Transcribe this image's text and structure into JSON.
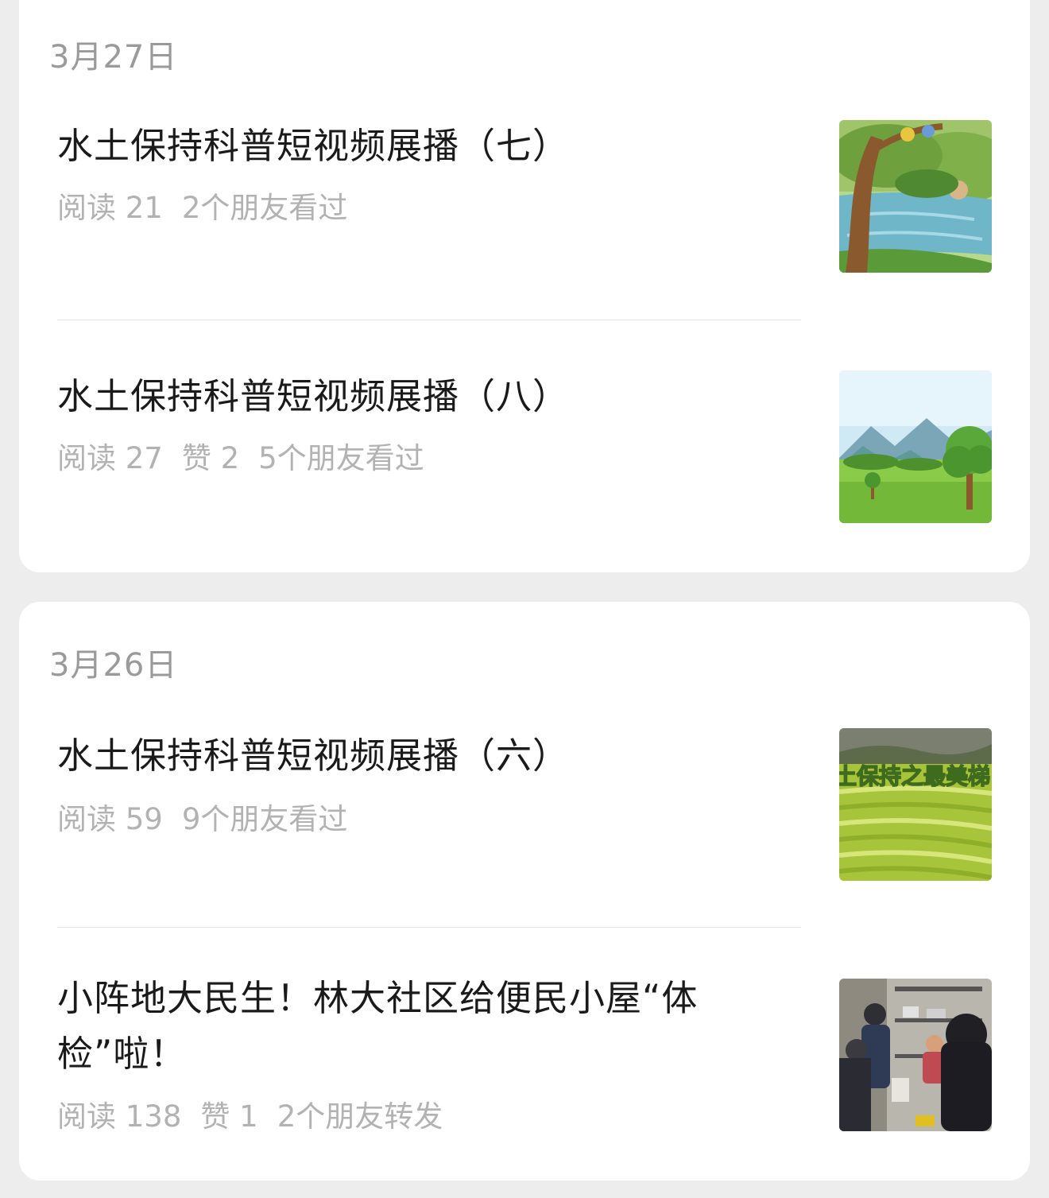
{
  "sections": [
    {
      "date": "3月27日",
      "articles": [
        {
          "title": "水土保持科普短视频展播（七）",
          "stats": [
            "阅读 21",
            "2个朋友看过"
          ],
          "thumbnail_icon": "cartoon-river-tree-thumbnail"
        },
        {
          "title": "水土保持科普短视频展播（八）",
          "stats": [
            "阅读 27",
            "赞 2",
            "5个朋友看过"
          ],
          "thumbnail_icon": "cartoon-mountain-meadow-thumbnail"
        }
      ]
    },
    {
      "date": "3月26日",
      "articles": [
        {
          "title": "水土保持科普短视频展播（六）",
          "stats": [
            "阅读 59",
            "9个朋友看过"
          ],
          "thumbnail_icon": "terraced-fields-thumbnail",
          "thumbnail_text": "土保持之最美梯"
        },
        {
          "title": "小阵地大民生！林大社区给便民小屋“体检”啦！",
          "stats": [
            "阅读 138",
            "赞 1",
            "2个朋友转发"
          ],
          "thumbnail_icon": "community-room-photo-thumbnail"
        }
      ]
    }
  ],
  "colors": {
    "background": "#ededed",
    "card": "#ffffff",
    "date_text": "#9a9a9a",
    "title_text": "#1a1a1a",
    "meta_text": "#b2b2b2"
  }
}
